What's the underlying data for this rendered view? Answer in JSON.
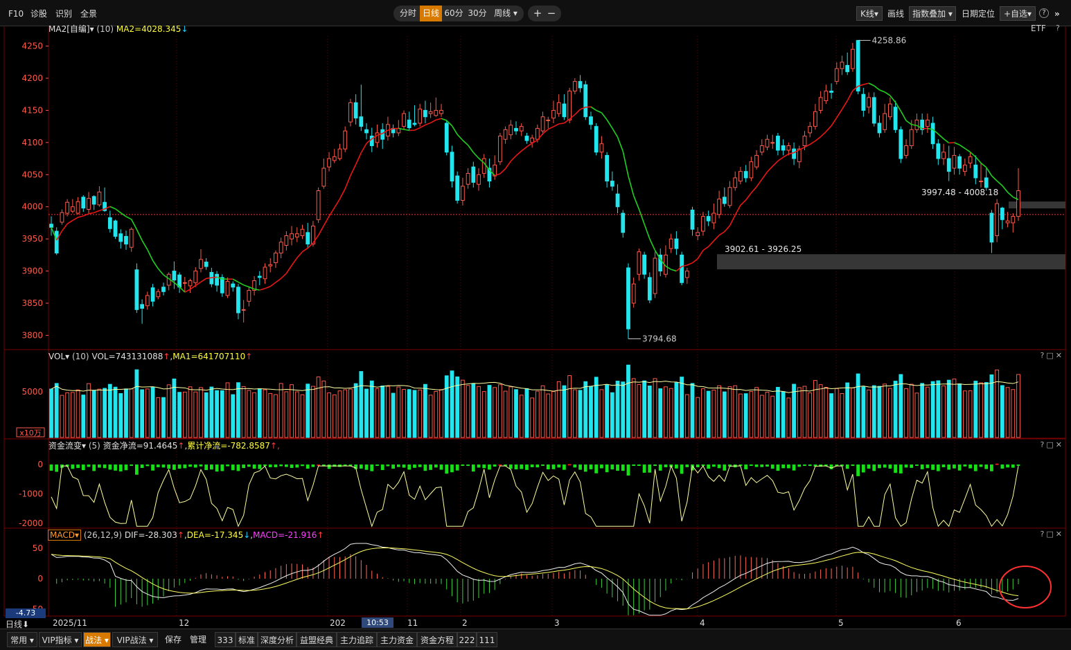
{
  "topbar": {
    "left": [
      "F10",
      "诊股",
      "识别",
      "全景"
    ],
    "periods": [
      "分时",
      "日线",
      "60分",
      "30分",
      "周线"
    ],
    "active_period": "日线",
    "zoom_in": "+",
    "zoom_out": "−",
    "kline_select": "K线",
    "draw": "画线",
    "index_overlay": "指数叠加",
    "date_locate": "日期定位",
    "watchlist": "+自选",
    "help": "?",
    "collapse": "»"
  },
  "main_panel": {
    "indicator": "MA2[自编]",
    "param": "(10)",
    "ma_text": "MA2=4028.345",
    "arrow": "↓",
    "right_label": "ETF",
    "help": "?",
    "y_ticks": [
      "4250",
      "4200",
      "4150",
      "4100",
      "4050",
      "4000",
      "3950",
      "3900",
      "3850",
      "3800"
    ],
    "high_label": "4258.86",
    "low_label": "3794.68",
    "gap_label_1": "3902.61 - 3926.25",
    "gap_label_2": "3997.48 - 4008.18"
  },
  "vol_panel": {
    "indicator": "VOL",
    "param": "(10)",
    "vol_text": "VOL=743131088",
    "vol_arrow": "↑",
    "ma_text": "MA1=641707110",
    "ma_arrow": "↑",
    "y_tick": "5000",
    "unit": "x10万"
  },
  "flow_panel": {
    "indicator": "资金流变",
    "param": "(5)",
    "net_text": "资金净流=91.4645",
    "net_arrow": "↑",
    "cum_text": "累计净流=-782.8587",
    "cum_arrow": "↑,",
    "y_ticks": [
      "0",
      "-1000",
      "-2000"
    ]
  },
  "macd_panel": {
    "indicator": "MACD",
    "param": "(26,12,9)",
    "dif_text": "DIF=-28.303",
    "dif_arrow": "↑",
    "dea_text": "DEA=-17.345",
    "dea_arrow": "↓",
    "macd_text": "MACD=-21.916",
    "macd_arrow": "↑",
    "y_ticks": [
      "50",
      "0",
      "-50"
    ],
    "cursor_value": "-4.73"
  },
  "x_axis": {
    "labels": [
      "2025/11",
      "12",
      "202",
      "11",
      "2",
      "3",
      "4",
      "5",
      "6"
    ],
    "cursor_time": "10:53",
    "period_label": "日线"
  },
  "bottombar": {
    "items": [
      "常用",
      "VIP指标",
      "战法",
      "VIP战法",
      "保存",
      "管理",
      "333",
      "标准",
      "深度分析",
      "益盟经典",
      "主力追踪",
      "主力资金",
      "资金方程",
      "222",
      "111"
    ],
    "active": "战法"
  },
  "colors": {
    "up": "#ff5a4a",
    "down": "#22e5ee",
    "ma_up": "#e81818",
    "ma_down": "#20d020",
    "flow_pos": "#e81818",
    "flow_neg": "#18e018",
    "grid": "#6b0000",
    "accent": "#d87a00"
  },
  "chart_data": {
    "type": "candlestick",
    "title": "",
    "ylim": [
      3780,
      4270
    ],
    "candles": [
      [
        3973,
        3968,
        3985,
        3955
      ],
      [
        3962,
        3928,
        3968,
        3925
      ],
      [
        3976,
        3991,
        3996,
        3972
      ],
      [
        3990,
        4007,
        4012,
        3985
      ],
      [
        3993,
        4000,
        4012,
        3990
      ],
      [
        3990,
        4008,
        4015,
        3988
      ],
      [
        4015,
        3998,
        4018,
        3992
      ],
      [
        3996,
        4013,
        4023,
        3990
      ],
      [
        4016,
        4004,
        4018,
        3995
      ],
      [
        4003,
        4023,
        4032,
        4000
      ],
      [
        4007,
        3994,
        4030,
        3992
      ],
      [
        3983,
        3966,
        3994,
        3960
      ],
      [
        3978,
        3954,
        3980,
        3950
      ],
      [
        3958,
        3946,
        3965,
        3935
      ],
      [
        3954,
        3942,
        3963,
        3933
      ],
      [
        3937,
        3965,
        3968,
        3930
      ],
      [
        3902,
        3840,
        3912,
        3835
      ],
      [
        3848,
        3842,
        3856,
        3818
      ],
      [
        3846,
        3862,
        3868,
        3840
      ],
      [
        3874,
        3853,
        3880,
        3845
      ],
      [
        3860,
        3868,
        3872,
        3856
      ],
      [
        3875,
        3868,
        3882,
        3862
      ],
      [
        3878,
        3895,
        3898,
        3870
      ],
      [
        3900,
        3886,
        3915,
        3872
      ],
      [
        3894,
        3875,
        3898,
        3866
      ],
      [
        3882,
        3882,
        3891,
        3868
      ],
      [
        3877,
        3885,
        3888,
        3866
      ],
      [
        3882,
        3900,
        3906,
        3875
      ],
      [
        3904,
        3918,
        3934,
        3898
      ],
      [
        3914,
        3907,
        3920,
        3902
      ],
      [
        3898,
        3880,
        3905,
        3875
      ],
      [
        3895,
        3878,
        3900,
        3868
      ],
      [
        3890,
        3866,
        3895,
        3860
      ],
      [
        3862,
        3884,
        3890,
        3858
      ],
      [
        3880,
        3875,
        3884,
        3868
      ],
      [
        3875,
        3835,
        3880,
        3825
      ],
      [
        3840,
        3840,
        3855,
        3820
      ],
      [
        3853,
        3870,
        3876,
        3845
      ],
      [
        3870,
        3885,
        3892,
        3862
      ],
      [
        3892,
        3890,
        3900,
        3878
      ],
      [
        3888,
        3906,
        3912,
        3880
      ],
      [
        3908,
        3910,
        3920,
        3898
      ],
      [
        3913,
        3928,
        3932,
        3905
      ],
      [
        3928,
        3945,
        3952,
        3920
      ],
      [
        3940,
        3955,
        3962,
        3932
      ],
      [
        3950,
        3958,
        3970,
        3940
      ],
      [
        3953,
        3958,
        3968,
        3945
      ],
      [
        3955,
        3965,
        3972,
        3950
      ],
      [
        3960,
        3942,
        3975,
        3935
      ],
      [
        3942,
        3970,
        3978,
        3938
      ],
      [
        3980,
        4025,
        4030,
        3975
      ],
      [
        4032,
        4060,
        4075,
        4028
      ],
      [
        4062,
        4075,
        4085,
        4055
      ],
      [
        4072,
        4078,
        4090,
        4068
      ],
      [
        4075,
        4090,
        4098,
        4072
      ],
      [
        4090,
        4118,
        4125,
        4085
      ],
      [
        4132,
        4162,
        4168,
        4125
      ],
      [
        4162,
        4138,
        4175,
        4128
      ],
      [
        4140,
        4125,
        4190,
        4118
      ],
      [
        4120,
        4115,
        4130,
        4105
      ],
      [
        4110,
        4095,
        4123,
        4085
      ],
      [
        4100,
        4115,
        4128,
        4092
      ],
      [
        4120,
        4105,
        4130,
        4090
      ],
      [
        4110,
        4128,
        4140,
        4103
      ],
      [
        4122,
        4115,
        4128,
        4108
      ],
      [
        4115,
        4122,
        4135,
        4110
      ],
      [
        4125,
        4145,
        4150,
        4120
      ],
      [
        4135,
        4123,
        4148,
        4118
      ],
      [
        4130,
        4128,
        4158,
        4125
      ],
      [
        4130,
        4152,
        4160,
        4125
      ],
      [
        4150,
        4140,
        4165,
        4130
      ],
      [
        4145,
        4148,
        4162,
        4138
      ],
      [
        4142,
        4150,
        4170,
        4140
      ],
      [
        4145,
        4150,
        4160,
        4140
      ],
      [
        4130,
        4085,
        4135,
        4080
      ],
      [
        4085,
        4040,
        4095,
        4030
      ],
      [
        4048,
        4010,
        4055,
        4005
      ],
      [
        4010,
        4032,
        4045,
        4002
      ],
      [
        4035,
        4052,
        4060,
        4028
      ],
      [
        4062,
        4038,
        4070,
        4030
      ],
      [
        4035,
        4050,
        4060,
        4025
      ],
      [
        4052,
        4075,
        4082,
        4045
      ],
      [
        4060,
        4040,
        4075,
        4030
      ],
      [
        4048,
        4065,
        4080,
        4042
      ],
      [
        4070,
        4110,
        4115,
        4065
      ],
      [
        4105,
        4120,
        4125,
        4098
      ],
      [
        4112,
        4127,
        4135,
        4105
      ],
      [
        4122,
        4118,
        4133,
        4112
      ],
      [
        4118,
        4125,
        4130,
        4110
      ],
      [
        4110,
        4103,
        4115,
        4098
      ],
      [
        4100,
        4107,
        4112,
        4092
      ],
      [
        4105,
        4122,
        4128,
        4100
      ],
      [
        4118,
        4140,
        4148,
        4112
      ],
      [
        4135,
        4135,
        4140,
        4122
      ],
      [
        4138,
        4150,
        4165,
        4130
      ],
      [
        4145,
        4162,
        4175,
        4140
      ],
      [
        4160,
        4140,
        4175,
        4135
      ],
      [
        4135,
        4180,
        4185,
        4130
      ],
      [
        4180,
        4195,
        4200,
        4175
      ],
      [
        4195,
        4185,
        4205,
        4178
      ],
      [
        4190,
        4140,
        4196,
        4135
      ],
      [
        4140,
        4128,
        4148,
        4120
      ],
      [
        4125,
        4085,
        4130,
        4080
      ],
      [
        4085,
        4098,
        4110,
        4075
      ],
      [
        4080,
        4040,
        4085,
        4030
      ],
      [
        4040,
        4032,
        4055,
        4025
      ],
      [
        4020,
        4000,
        4035,
        3990
      ],
      [
        3990,
        3960,
        3995,
        3952
      ],
      [
        3905,
        3810,
        3912,
        3794.68
      ],
      [
        3850,
        3880,
        3890,
        3843
      ],
      [
        3895,
        3930,
        3935,
        3885
      ],
      [
        3925,
        3895,
        3930,
        3888
      ],
      [
        3890,
        3855,
        3898,
        3850
      ],
      [
        3865,
        3920,
        3930,
        3858
      ],
      [
        3925,
        3900,
        3935,
        3892
      ],
      [
        3895,
        3925,
        3940,
        3890
      ],
      [
        3935,
        3950,
        3958,
        3928
      ],
      [
        3950,
        3935,
        3962,
        3925
      ],
      [
        3925,
        3882,
        3930,
        3878
      ],
      [
        3890,
        3900,
        3905,
        3880
      ],
      [
        3995,
        3965,
        4000,
        3955
      ],
      [
        3955,
        3960,
        3968,
        3948
      ],
      [
        3962,
        3985,
        3992,
        3955
      ],
      [
        3985,
        3978,
        3994,
        3970
      ],
      [
        3975,
        3990,
        4005,
        3965
      ],
      [
        3988,
        4012,
        4025,
        3982
      ],
      [
        4015,
        4005,
        4030,
        4000
      ],
      [
        4002,
        4030,
        4040,
        3998
      ],
      [
        4030,
        4045,
        4055,
        4025
      ],
      [
        4040,
        4055,
        4062,
        4035
      ],
      [
        4055,
        4045,
        4065,
        4038
      ],
      [
        4045,
        4070,
        4078,
        4040
      ],
      [
        4062,
        4080,
        4088,
        4058
      ],
      [
        4085,
        4095,
        4105,
        4080
      ],
      [
        4093,
        4105,
        4112,
        4088
      ],
      [
        4100,
        4100,
        4112,
        4090
      ],
      [
        4110,
        4088,
        4115,
        4080
      ],
      [
        4095,
        4088,
        4105,
        4080
      ],
      [
        4088,
        4095,
        4100,
        4080
      ],
      [
        4090,
        4075,
        4100,
        4065
      ],
      [
        4070,
        4090,
        4095,
        4060
      ],
      [
        4095,
        4110,
        4118,
        4088
      ],
      [
        4115,
        4125,
        4132,
        4108
      ],
      [
        4125,
        4148,
        4160,
        4120
      ],
      [
        4150,
        4170,
        4180,
        4145
      ],
      [
        4165,
        4180,
        4190,
        4160
      ],
      [
        4180,
        4178,
        4192,
        4168
      ],
      [
        4195,
        4215,
        4225,
        4190
      ],
      [
        4215,
        4225,
        4235,
        4205
      ],
      [
        4220,
        4210,
        4240,
        4205
      ],
      [
        4215,
        4245,
        4255,
        4210
      ],
      [
        4258.86,
        4180,
        4258.86,
        4175
      ],
      [
        4175,
        4150,
        4185,
        4140
      ],
      [
        4155,
        4170,
        4178,
        4145
      ],
      [
        4170,
        4130,
        4178,
        4125
      ],
      [
        4130,
        4115,
        4142,
        4108
      ],
      [
        4120,
        4145,
        4160,
        4115
      ],
      [
        4140,
        4160,
        4170,
        4135
      ],
      [
        4155,
        4120,
        4165,
        4115
      ],
      [
        4120,
        4075,
        4125,
        4068
      ],
      [
        4080,
        4095,
        4105,
        4075
      ],
      [
        4095,
        4120,
        4135,
        4090
      ],
      [
        4120,
        4135,
        4145,
        4115
      ],
      [
        4135,
        4120,
        4145,
        4112
      ],
      [
        4125,
        4135,
        4145,
        4115
      ],
      [
        4130,
        4098,
        4140,
        4090
      ],
      [
        4098,
        4075,
        4105,
        4065
      ],
      [
        4075,
        4085,
        4098,
        4065
      ],
      [
        4075,
        4055,
        4095,
        4040
      ],
      [
        4060,
        4080,
        4093,
        4050
      ],
      [
        4078,
        4060,
        4082,
        4050
      ],
      [
        4055,
        4065,
        4075,
        4048
      ],
      [
        4068,
        4078,
        4085,
        4060
      ],
      [
        4065,
        4045,
        4080,
        4035
      ],
      [
        4040,
        4040,
        4068,
        4030
      ],
      [
        4045,
        4030,
        4060,
        4025
      ],
      [
        3990,
        3945,
        3995,
        3928
      ],
      [
        3955,
        4005,
        4012,
        3945
      ],
      [
        3998,
        3980,
        4000,
        3965
      ],
      [
        3975,
        3978,
        3992,
        3968
      ],
      [
        3975,
        3985,
        3990,
        3960
      ],
      [
        3985,
        4025,
        4060,
        3978
      ]
    ]
  }
}
